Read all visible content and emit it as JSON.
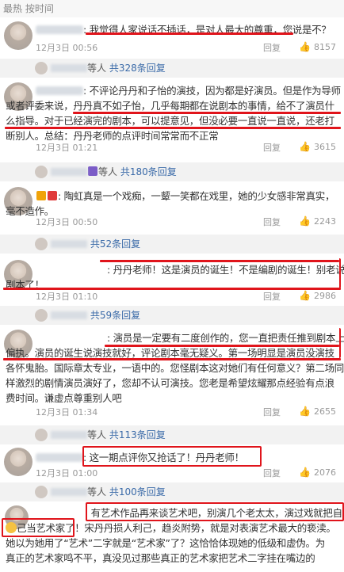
{
  "header": {
    "text": "最热 按时间"
  },
  "comments": [
    {
      "lines": [
        ": 我觉得人家说话不插话，是对人最大的尊重，您说是不？"
      ],
      "time": "12月3日 00:56",
      "reply": "回复",
      "likes": "8157"
    },
    {
      "reply_summary": {
        "prefix": "等人",
        "link": "共328条回复"
      }
    },
    {
      "lines": [
        ": 不评论丹丹和子怡的演技，因为都是好演员。但是作为导师",
        "或者评委来说，丹丹真不如子怡，几乎每期都在说剧本的事情，给不了演员什",
        "么指导。对于已经演完的剧本，可以提意见，但没必要一直说一直说，还老打",
        "断别人。总结：丹丹老师的点评时间常常而不正常"
      ],
      "time": "12月3日 01:21",
      "reply": "回复",
      "likes": "3615"
    },
    {
      "reply_summary": {
        "prefix": "等人",
        "link": "共180条回复"
      }
    },
    {
      "lines": [
        ": 陶虹真是一个戏痴，一颦一笑都在戏里，她的少女感非常真实，",
        "毫不造作。"
      ],
      "time": "12月3日 00:50",
      "reply": "回复",
      "likes": "2243"
    },
    {
      "reply_summary": {
        "prefix": "",
        "link": "共52条回复"
      }
    },
    {
      "lines": [
        ": 丹丹老师！这是演员的诞生！不是编剧的诞生！别老说",
        "剧本了！"
      ],
      "time": "12月3日 01:10",
      "reply": "回复",
      "likes": "2986"
    },
    {
      "reply_summary": {
        "prefix": "",
        "link": "共59条回复"
      }
    },
    {
      "lines": [
        ": 演员是一定要有二度创作的，您一直把责任推到剧本上是",
        "偏执。演员的诞生说演技就好，评论剧本毫无疑义。第一场明显是演员没演技",
        "各怀鬼胎。国际章太专业，一语中的。您怪剧本这对她们有任何意义？第二场同",
        "样激烈的剧情演员演好了，您却不认可演技。您老是希望炫耀那点经验有点浪",
        "费时间。谦虚点尊重别人吧"
      ],
      "time": "12月3日 01:34",
      "reply": "回复",
      "likes": "2655"
    },
    {
      "reply_summary": {
        "prefix": "等人",
        "link": "共113条回复"
      }
    },
    {
      "lines": [
        ": 这一期点评你又抢话了！丹丹老师！"
      ],
      "time": "12月3日 01:00",
      "reply": "回复",
      "likes": "2076"
    },
    {
      "reply_summary": {
        "prefix": "等人",
        "link": "共100条回复"
      }
    },
    {
      "lines": [
        ": 有艺术作品再来谈艺术吧，别演几个老太太，演过戏就把自",
        "己当艺术家了！宋丹丹损人利己，趋炎附势，就是对表演艺术最大的亵渎。",
        "她以为她用了“艺术”二字就是“艺术家”了？这恰恰体现她的低级和虚伪。为",
        "真正的艺术家鸣不平，真没见过那些真正的艺术家把艺术二字挂在嘴边的"
      ],
      "time": "",
      "reply": "",
      "likes": ""
    }
  ],
  "colors": {
    "highlight": "#e0141b",
    "link": "#3a6aa8",
    "meta": "#999999",
    "reply_bg": "#f2f2f2"
  }
}
